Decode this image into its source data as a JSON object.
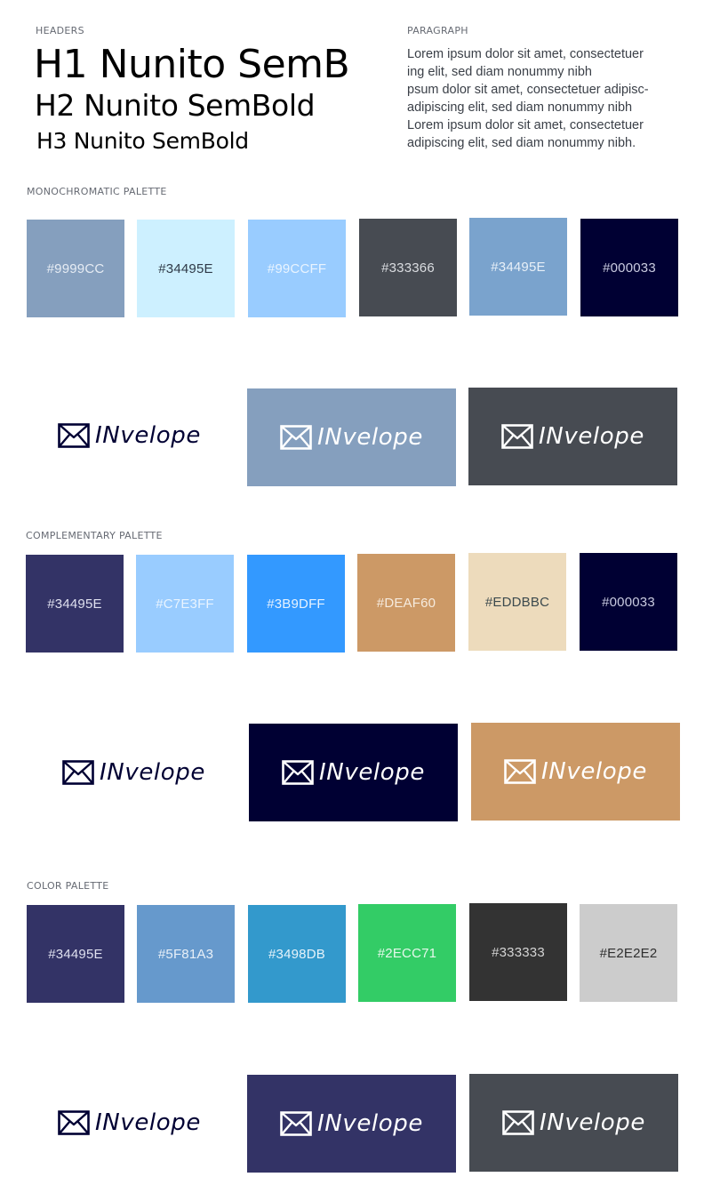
{
  "headers": {
    "caption": "HEADERS",
    "h1": "H1 Nunito SemB",
    "h2": "H2 Nunito SemBold",
    "h3": "H3 Nunito SemBold"
  },
  "paragraph": {
    "caption": "PARAGRAPH",
    "lines": [
      "Lorem ipsum dolor sit amet, consectetuer",
      "ing elit, sed diam nonummy nibh",
      "psum dolor sit amet, consectetuer adipisc-",
      "adipiscing elit, sed diam nonummy nibh",
      "Lorem ipsum dolor sit amet, consectetuer",
      "adipiscing elit, sed diam nonummy nibh."
    ]
  },
  "brand_name": "INvelope",
  "sections": [
    {
      "caption": "MONOCHROMATIC  PALETTE",
      "swatches": [
        {
          "label": "#9999CC",
          "color": "#859fbe",
          "text_color": "#e6ecf4"
        },
        {
          "label": "#34495E",
          "color": "#cdf0ff",
          "text_color": "#2f3a48"
        },
        {
          "label": "#99CCFF",
          "color": "#99ccff",
          "text_color": "#e9f4ff"
        },
        {
          "label": "#333366",
          "color": "#474b52",
          "text_color": "#dadce0"
        },
        {
          "label": "#34495E",
          "color": "#7aa3cd",
          "text_color": "#e8f0f8"
        },
        {
          "label": "#000033",
          "color": "#000033",
          "text_color": "#c9cbe0"
        }
      ],
      "logos": [
        {
          "bg": "#ffffff",
          "fg": "#000033"
        },
        {
          "bg": "#859fbe",
          "fg": "#ffffff"
        },
        {
          "bg": "#474b52",
          "fg": "#ffffff"
        }
      ]
    },
    {
      "caption": "COMPLEMENTARY PALETTE",
      "swatches": [
        {
          "label": "#34495E",
          "color": "#333366",
          "text_color": "#dfe0ef"
        },
        {
          "label": "#C7E3FF",
          "color": "#99ccff",
          "text_color": "#e9f4ff"
        },
        {
          "label": "#3B9DFF",
          "color": "#3399ff",
          "text_color": "#e6f2ff"
        },
        {
          "label": "#DEAF60",
          "color": "#cc9966",
          "text_color": "#f6ebde"
        },
        {
          "label": "#EDDBBC",
          "color": "#eddbbc",
          "text_color": "#3c4a4e"
        },
        {
          "label": "#000033",
          "color": "#000033",
          "text_color": "#c9cbe0"
        }
      ],
      "logos": [
        {
          "bg": "#ffffff",
          "fg": "#000033"
        },
        {
          "bg": "#000033",
          "fg": "#ffffff"
        },
        {
          "bg": "#cc9966",
          "fg": "#ffffff"
        }
      ]
    },
    {
      "caption": "COLOR PALETTE",
      "swatches": [
        {
          "label": "#34495E",
          "color": "#333366",
          "text_color": "#dfe0ef"
        },
        {
          "label": "#5F81A3",
          "color": "#6699cc",
          "text_color": "#e8f0f8"
        },
        {
          "label": "#3498DB",
          "color": "#3399cc",
          "text_color": "#e6f3fa"
        },
        {
          "label": "#2ECC71",
          "color": "#33cc66",
          "text_color": "#e6f8ec"
        },
        {
          "label": "#333333",
          "color": "#333333",
          "text_color": "#d4d4d4"
        },
        {
          "label": "#E2E2E2",
          "color": "#cccccc",
          "text_color": "#2e2e2e"
        }
      ],
      "logos": [
        {
          "bg": "#ffffff",
          "fg": "#000033"
        },
        {
          "bg": "#333366",
          "fg": "#ffffff"
        },
        {
          "bg": "#474b52",
          "fg": "#ffffff"
        }
      ]
    }
  ]
}
